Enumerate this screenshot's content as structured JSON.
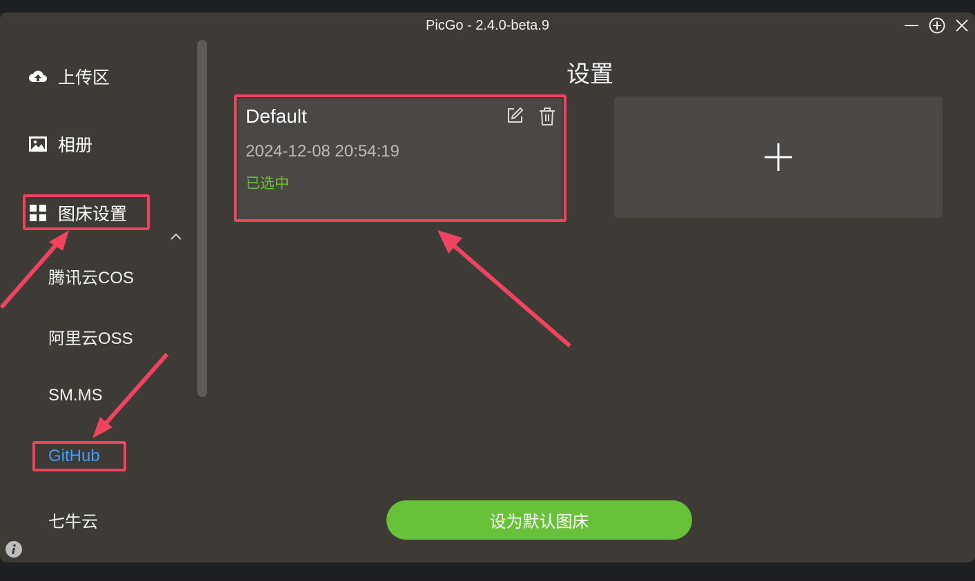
{
  "window": {
    "title": "PicGo - 2.4.0-beta.9"
  },
  "sidebar": {
    "items": [
      {
        "label": "上传区",
        "icon": "cloud-upload-icon"
      },
      {
        "label": "相册",
        "icon": "image-icon"
      },
      {
        "label": "图床设置",
        "icon": "grid-icon"
      }
    ],
    "sub_items": [
      {
        "label": "腾讯云COS"
      },
      {
        "label": "阿里云OSS"
      },
      {
        "label": "SM.MS"
      },
      {
        "label": "GitHub",
        "active": true
      },
      {
        "label": "七牛云"
      }
    ]
  },
  "main": {
    "title": "设置",
    "config_card": {
      "name": "Default",
      "date": "2024-12-08 20:54:19",
      "status": "已选中"
    },
    "set_default_label": "设为默认图床"
  },
  "colors": {
    "window_bg": "#3e3b37",
    "accent_green": "#67c23a",
    "active_link": "#409eff",
    "annotation_red": "#f0435f"
  }
}
